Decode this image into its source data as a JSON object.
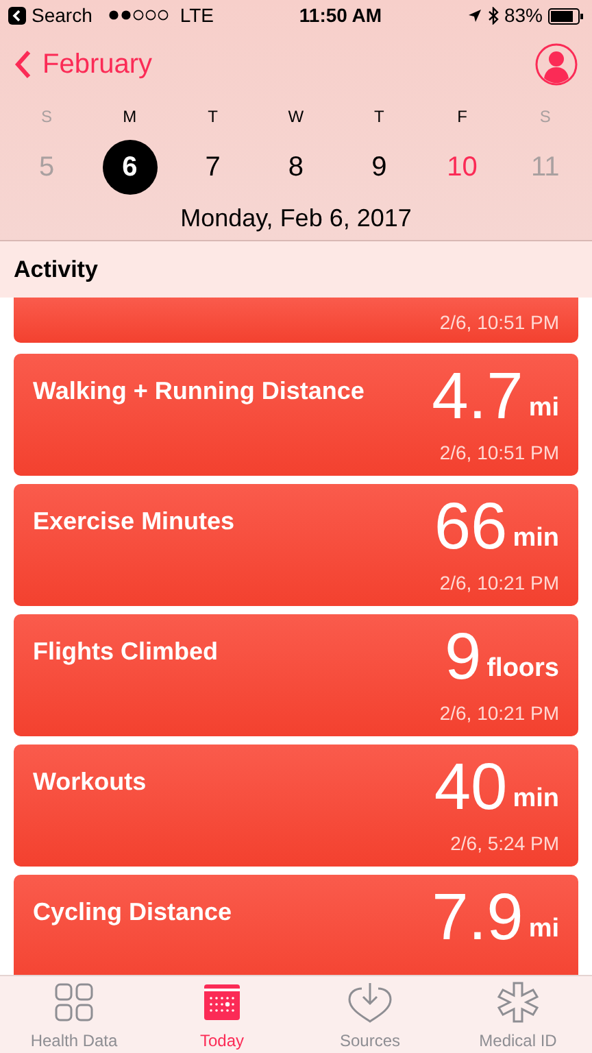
{
  "status_bar": {
    "back_label": "Search",
    "carrier": "LTE",
    "time": "11:50 AM",
    "battery": "83%"
  },
  "nav": {
    "back": "February"
  },
  "week": [
    {
      "letter": "S",
      "date": "5",
      "selected": false,
      "today": false,
      "muted": true
    },
    {
      "letter": "M",
      "date": "6",
      "selected": true,
      "today": false,
      "muted": false
    },
    {
      "letter": "T",
      "date": "7",
      "selected": false,
      "today": false,
      "muted": false
    },
    {
      "letter": "W",
      "date": "8",
      "selected": false,
      "today": false,
      "muted": false
    },
    {
      "letter": "T",
      "date": "9",
      "selected": false,
      "today": false,
      "muted": false
    },
    {
      "letter": "F",
      "date": "10",
      "selected": false,
      "today": true,
      "muted": false
    },
    {
      "letter": "S",
      "date": "11",
      "selected": false,
      "today": false,
      "muted": true
    }
  ],
  "date_title": "Monday, Feb 6, 2017",
  "section": "Activity",
  "cards": [
    {
      "kind": "partial",
      "time": "2/6, 10:51 PM"
    },
    {
      "kind": "full",
      "title": "Walking + Running Distance",
      "value": "4.7",
      "unit": "mi",
      "time": "2/6, 10:51 PM"
    },
    {
      "kind": "full",
      "title": "Exercise Minutes",
      "value": "66",
      "unit": "min",
      "time": "2/6, 10:21 PM"
    },
    {
      "kind": "full",
      "title": "Flights Climbed",
      "value": "9",
      "unit": "floors",
      "time": "2/6, 10:21 PM"
    },
    {
      "kind": "full",
      "title": "Workouts",
      "value": "40",
      "unit": "min",
      "time": "2/6, 5:24 PM"
    },
    {
      "kind": "full",
      "title": "Cycling Distance",
      "value": "7.9",
      "unit": "mi"
    }
  ],
  "tabs": [
    {
      "label": "Health Data",
      "kind": "grid",
      "selected": false
    },
    {
      "label": "Today",
      "kind": "calendar",
      "selected": true
    },
    {
      "label": "Sources",
      "kind": "heart",
      "selected": false
    },
    {
      "label": "Medical ID",
      "kind": "asterisk",
      "selected": false
    }
  ]
}
